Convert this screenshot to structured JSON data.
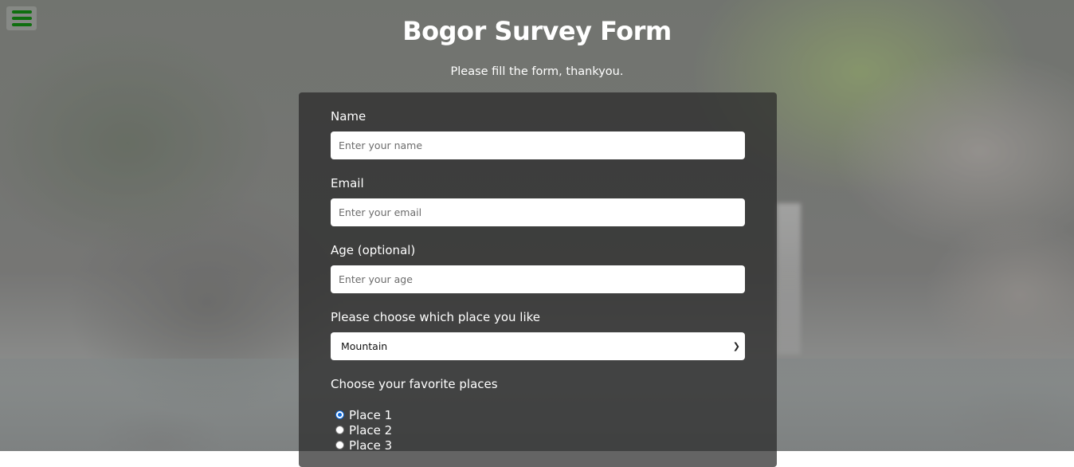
{
  "header": {
    "title": "Bogor Survey Form",
    "description": "Please fill the form, thankyou."
  },
  "menu": {
    "icon": "hamburger-menu-icon",
    "color": "#0f6e0f"
  },
  "form": {
    "name": {
      "label": "Name",
      "placeholder": "Enter your name"
    },
    "email": {
      "label": "Email",
      "placeholder": "Enter your email"
    },
    "age": {
      "label": "Age (optional)",
      "placeholder": "Enter your age"
    },
    "place": {
      "label": "Please choose which place you like",
      "selected": "Mountain"
    },
    "favorites": {
      "label": "Choose your favorite places",
      "options": [
        {
          "label": "Place 1",
          "checked": true
        },
        {
          "label": "Place 2",
          "checked": false
        },
        {
          "label": "Place 3",
          "checked": false
        }
      ]
    }
  }
}
